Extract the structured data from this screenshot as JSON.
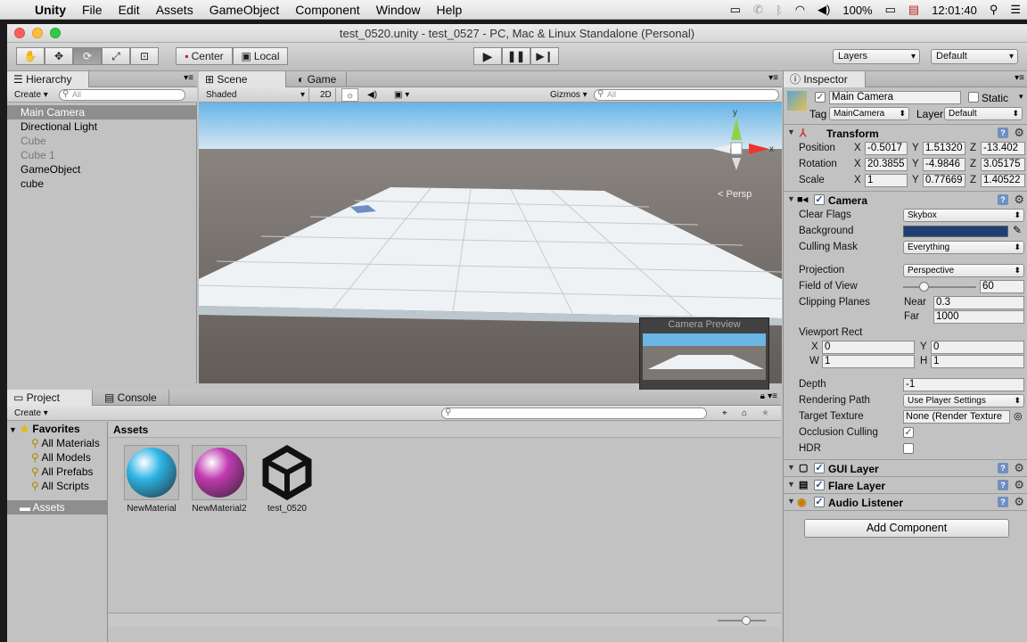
{
  "menubar": {
    "app": "Unity",
    "items": [
      "File",
      "Edit",
      "Assets",
      "GameObject",
      "Component",
      "Window",
      "Help"
    ],
    "battery": "100%",
    "clock": "12:01:40"
  },
  "window": {
    "title": "test_0520.unity - test_0527 - PC, Mac & Linux Standalone (Personal)"
  },
  "toolbar": {
    "pivot": "Center",
    "space": "Local",
    "layers": "Layers",
    "layout": "Default"
  },
  "hierarchy": {
    "tab": "Hierarchy",
    "create": "Create",
    "search_placeholder": "All",
    "items": [
      "Main Camera",
      "Directional Light",
      "Cube",
      "Cube 1",
      "GameObject",
      "cube"
    ]
  },
  "scene": {
    "tab_scene": "Scene",
    "tab_game": "Game",
    "shading": "Shaded",
    "mode2d": "2D",
    "gizmos": "Gizmos",
    "search_placeholder": "All",
    "persp": "Persp",
    "axis_y": "y",
    "axis_x": "x",
    "preview_title": "Camera Preview"
  },
  "project": {
    "tab_project": "Project",
    "tab_console": "Console",
    "create": "Create",
    "favorites_label": "Favorites",
    "favorites": [
      "All Materials",
      "All Models",
      "All Prefabs",
      "All Scripts"
    ],
    "assets_folder": "Assets",
    "breadcrumb": "Assets",
    "assets": [
      {
        "name": "NewMaterial",
        "color": "#2fb5e6"
      },
      {
        "name": "NewMaterial2",
        "color": "#c03bb0"
      },
      {
        "name": "test_0520",
        "color": "#111111"
      }
    ]
  },
  "inspector": {
    "tab": "Inspector",
    "object_name": "Main Camera",
    "static_label": "Static",
    "tag_label": "Tag",
    "tag_value": "MainCamera",
    "layer_label": "Layer",
    "layer_value": "Default",
    "transform": {
      "title": "Transform",
      "position_label": "Position",
      "rotation_label": "Rotation",
      "scale_label": "Scale",
      "axis_x": "X",
      "axis_y": "Y",
      "axis_z": "Z",
      "position": [
        "-0.5017",
        "1.51320",
        "-13.402"
      ],
      "rotation": [
        "20.3855",
        "-4.9846",
        "3.05175"
      ],
      "scale": [
        "1",
        "0.77669",
        "1.40522"
      ]
    },
    "camera": {
      "title": "Camera",
      "clear_flags_label": "Clear Flags",
      "clear_flags": "Skybox",
      "background_label": "Background",
      "background_color": "#1f3f72",
      "culling_mask_label": "Culling Mask",
      "culling_mask": "Everything",
      "projection_label": "Projection",
      "projection": "Perspective",
      "fov_label": "Field of View",
      "fov": "60",
      "fov_fraction": 0.28,
      "clipping_label": "Clipping Planes",
      "near_label": "Near",
      "near": "0.3",
      "far_label": "Far",
      "far": "1000",
      "viewport_label": "Viewport Rect",
      "vx_label": "X",
      "vx": "0",
      "vy_label": "Y",
      "vy": "0",
      "vw_label": "W",
      "vw": "1",
      "vh_label": "H",
      "vh": "1",
      "depth_label": "Depth",
      "depth": "-1",
      "rendering_path_label": "Rendering Path",
      "rendering_path": "Use Player Settings",
      "target_texture_label": "Target Texture",
      "target_texture": "None (Render Texture",
      "occlusion_label": "Occlusion Culling",
      "hdr_label": "HDR"
    },
    "components": [
      "GUI Layer",
      "Flare Layer",
      "Audio Listener"
    ],
    "add_component": "Add Component"
  }
}
